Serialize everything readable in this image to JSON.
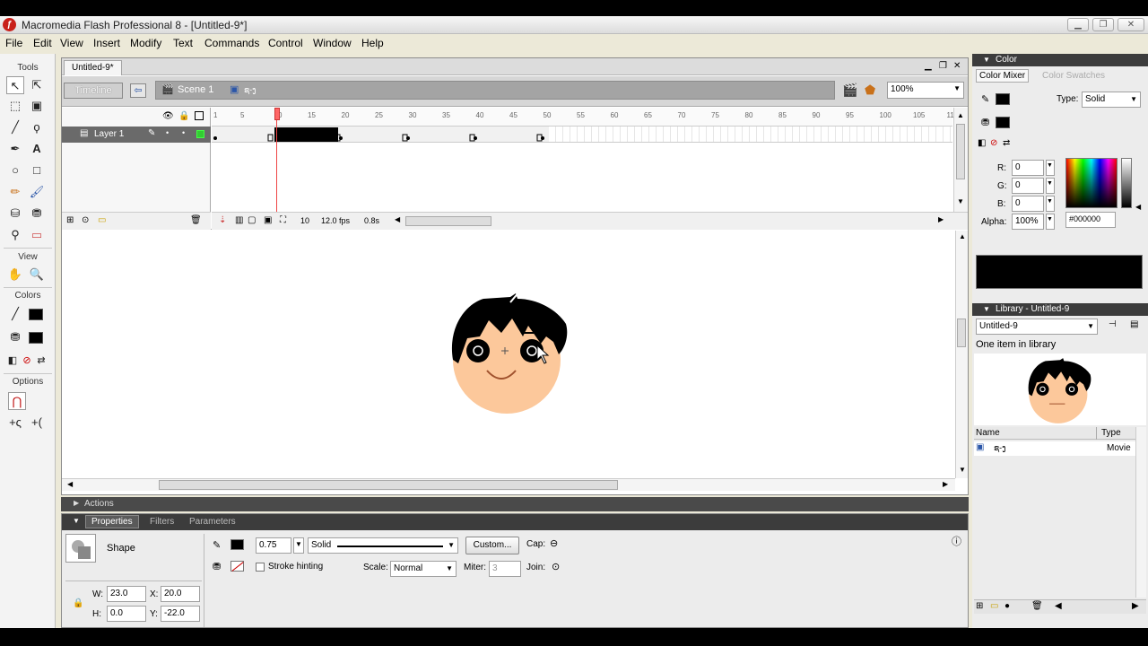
{
  "window": {
    "title": "Macromedia Flash Professional 8 - [Untitled-9*]"
  },
  "menu": [
    "File",
    "Edit",
    "View",
    "Insert",
    "Modify",
    "Text",
    "Commands",
    "Control",
    "Window",
    "Help"
  ],
  "tools": {
    "title": "Tools",
    "view_label": "View",
    "colors_label": "Colors",
    "options_label": "Options"
  },
  "document": {
    "tab": "Untitled-9*",
    "timeline_label": "Timeline",
    "scene_label": "Scene 1",
    "symbol_name": "ຊ-ງ",
    "zoom": "100%"
  },
  "timeline": {
    "layer_name": "Layer 1",
    "ruler_numbers": [
      "1",
      "5",
      "10",
      "15",
      "20",
      "25",
      "30",
      "35",
      "40",
      "45",
      "50",
      "55",
      "60",
      "65",
      "70",
      "75",
      "80",
      "85",
      "90",
      "95",
      "100",
      "105",
      "11"
    ],
    "current_frame": "10",
    "fps": "12.0 fps",
    "time": "0.8s"
  },
  "actions_label": "Actions",
  "properties": {
    "tabs": [
      "Properties",
      "Filters",
      "Parameters"
    ],
    "object_type": "Shape",
    "stroke_height": "0.75",
    "stroke_style": "Solid",
    "custom_button": "Custom...",
    "cap_label": "Cap:",
    "join_label": "Join:",
    "stroke_hinting": "Stroke hinting",
    "scale_label": "Scale:",
    "scale_value": "Normal",
    "miter_label": "Miter:",
    "miter_value": "3",
    "w_label": "W:",
    "w_value": "23.0",
    "h_label": "H:",
    "h_value": "0.0",
    "x_label": "X:",
    "x_value": "20.0",
    "y_label": "Y:",
    "y_value": "-22.0"
  },
  "color_panel": {
    "title": "Color",
    "tab_mixer": "Color Mixer",
    "tab_swatches": "Color Swatches",
    "type_label": "Type:",
    "type_value": "Solid",
    "r_label": "R:",
    "r_value": "0",
    "g_label": "G:",
    "g_value": "0",
    "b_label": "B:",
    "b_value": "0",
    "alpha_label": "Alpha:",
    "alpha_value": "100%",
    "hex_value": "#000000"
  },
  "library": {
    "title": "Library - Untitled-9",
    "selector": "Untitled-9",
    "count_text": "One item in library",
    "col_name": "Name",
    "col_type": "Type",
    "items": [
      {
        "name": "ຊ-ງ",
        "type": "Movie"
      }
    ]
  },
  "colors": {
    "skin": "#fcc89b",
    "hair": "#000000",
    "chrome": "#ece9d8",
    "selected_layer": "#6a6a6a"
  }
}
